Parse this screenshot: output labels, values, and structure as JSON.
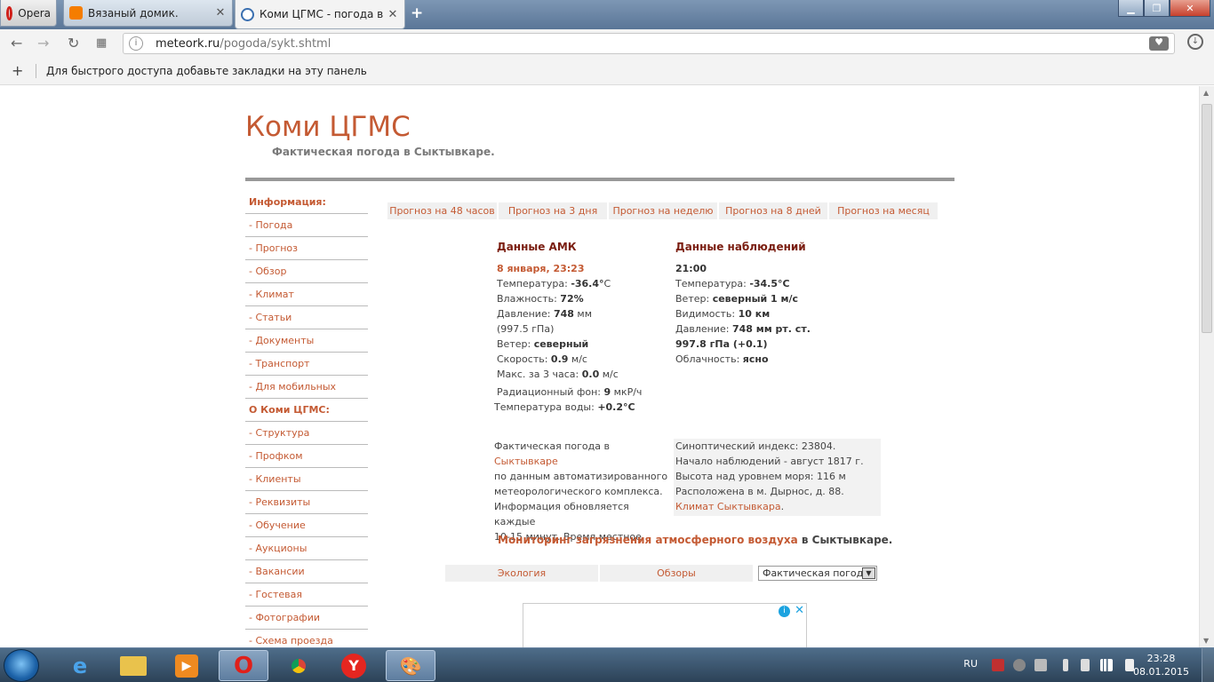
{
  "browser": {
    "menu_label": "Opera",
    "tabs": [
      {
        "title": "Вязаный домик.",
        "favicon": "blogger-icon"
      },
      {
        "title": "Коми ЦГМС - погода в Сыктывкаре",
        "favicon": "meteork-icon"
      }
    ],
    "url_host": "meteork.ru",
    "url_path": "/pogoda/sykt.shtml",
    "bookmarks_hint": "Для быстрого доступа добавьте закладки на эту панель"
  },
  "site": {
    "title": "Коми ЦГМС",
    "subtitle": "Фактическая погода в Сыктывкаре."
  },
  "sidebar": {
    "section1": "Информация:",
    "items1": [
      "- Погода",
      "- Прогноз",
      "- Обзор",
      "- Климат",
      "- Статьи",
      "- Документы",
      "- Транспорт",
      "- Для мобильных"
    ],
    "section2": "О Коми ЦГМС:",
    "items2": [
      "- Структура",
      "- Профком",
      "- Клиенты",
      "- Реквизиты",
      "- Обучение",
      "- Аукционы",
      "- Вакансии",
      "- Гостевая",
      "- Фотографии",
      "- Схема проезда"
    ]
  },
  "forecast_tabs": [
    "Прогноз на 48 часов",
    "Прогноз на 3 дня",
    "Прогноз на неделю",
    "Прогноз на 8 дней",
    "Прогноз на месяц"
  ],
  "amk": {
    "heading": "Данные АМК",
    "datetime": "8 января, 23:23",
    "temp_label": "Температура: ",
    "temp_value": "-36.4°",
    "temp_unit": "C",
    "hum_label": "Влажность: ",
    "hum_value": "72%",
    "press_label": "Давление: ",
    "press_value": "748",
    "press_unit": " мм",
    "press_hpa": "(997.5 гПа)",
    "wind_label": "Ветер: ",
    "wind_value": "северный",
    "speed_label": "Скорость: ",
    "speed_value": "0.9",
    "speed_unit": " м/с",
    "max_label": "Макс. за 3 часа: ",
    "max_value": "0.0",
    "max_unit": " м/с",
    "rad_label": "Радиационный фон: ",
    "rad_value": "9",
    "rad_unit": " мкР/ч",
    "water_label": "Температура воды: ",
    "water_value": "+0.2°C"
  },
  "obs": {
    "heading": "Данные наблюдений",
    "time": "21:00",
    "temp_label": "Температура: ",
    "temp_value": "-34.5°C",
    "wind_label": "Ветер: ",
    "wind_value": "северный 1 м/с",
    "vis_label": "Видимость: ",
    "vis_value": "10 км",
    "press_label": "Давление: ",
    "press_value": "748 мм рт. ст.",
    "press_hpa": "997.8 гПа (+0.1)",
    "cloud_label": "Облачность: ",
    "cloud_value": "ясно"
  },
  "info": {
    "l1a": "Фактическая погода в ",
    "l1link": "Сыктывкаре",
    "l2": "по данным автоматизированного",
    "l3": "метеорологического комплекса.",
    "l4": "Информация обновляется каждые",
    "l5": "10-15 минут. Время местное."
  },
  "station": {
    "l1": "Синоптический индекс: 23804.",
    "l2": "Начало наблюдений - август 1817 г.",
    "l3": "Высота над уровнем моря: 116 м",
    "l4": "Расположена в м. Дырнос, д. 88.",
    "link": "Климат Сыктывкара",
    "link_end": "."
  },
  "monitoring": {
    "link": "Мониторинг загрязнения атмосферного воздуха",
    "rest": " в Сыктывкаре."
  },
  "bottom_tabs": [
    "Экология",
    "Обзоры"
  ],
  "bottom_select": "Фактическая погода",
  "taskbar": {
    "lang": "RU",
    "time": "23:28",
    "date": "08.01.2015",
    "apps": [
      "internet-explorer-icon",
      "file-explorer-icon",
      "media-player-icon",
      "opera-icon",
      "chrome-icon",
      "yandex-icon",
      "paint-icon"
    ]
  }
}
